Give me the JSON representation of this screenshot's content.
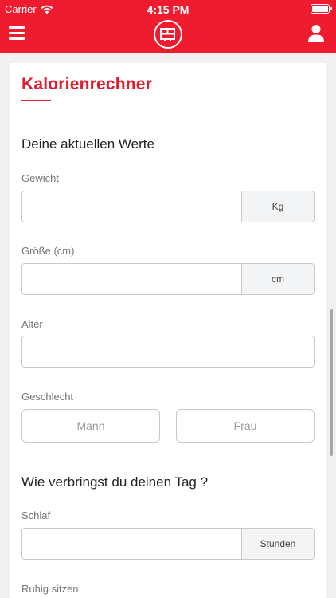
{
  "status": {
    "carrier": "Carrier",
    "time": "4:15 PM"
  },
  "page": {
    "title": "Kalorienrechner"
  },
  "current_values": {
    "heading": "Deine aktuellen Werte",
    "weight": {
      "label": "Gewicht",
      "value": "",
      "unit": "Kg"
    },
    "height": {
      "label": "Größe (cm)",
      "value": "",
      "unit": "cm"
    },
    "age": {
      "label": "Alter",
      "value": ""
    },
    "gender": {
      "label": "Geschlecht",
      "male": "Mann",
      "female": "Frau"
    }
  },
  "day": {
    "heading": "Wie verbringst du deinen Tag ?",
    "sleep": {
      "label": "Schlaf",
      "value": "",
      "unit": "Stunden"
    },
    "sitting": {
      "label": "Ruhig sitzen"
    }
  },
  "colors": {
    "brand": "#ee1c2e",
    "accent": "#e31b2d"
  }
}
